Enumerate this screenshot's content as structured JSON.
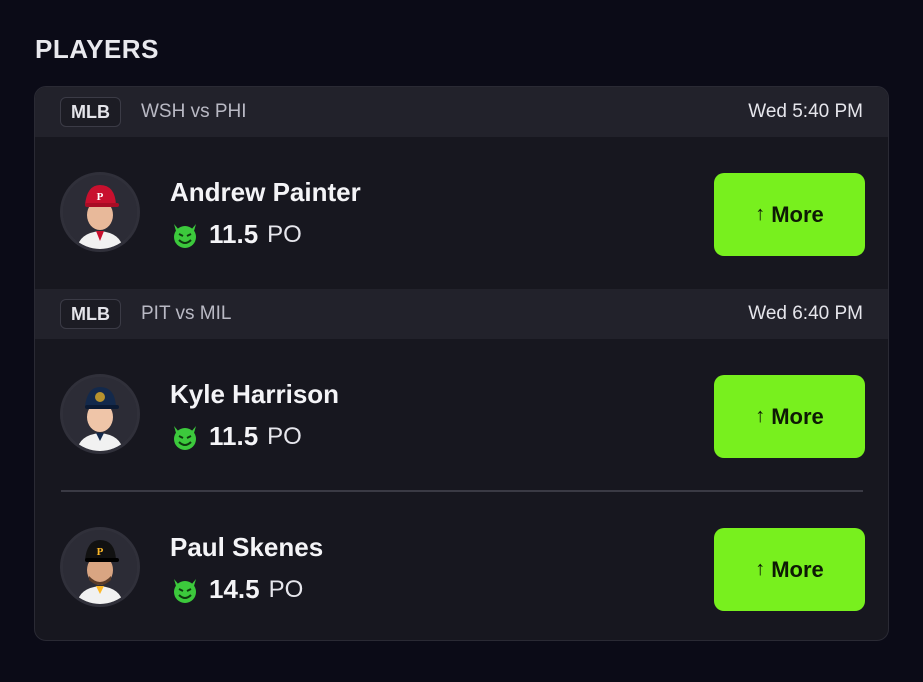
{
  "section": {
    "title": "PLAYERS"
  },
  "games": [
    {
      "league": "MLB",
      "matchup": "WSH vs PHI",
      "time": "Wed 5:40 PM",
      "players": [
        {
          "name": "Andrew Painter",
          "value": "11.5",
          "stat": "PO",
          "button_label": "More",
          "cap_color": "#c8102e",
          "cap_letter": "P",
          "jersey_color": "#f1f1f1",
          "accent": "#c8102e"
        }
      ]
    },
    {
      "league": "MLB",
      "matchup": "PIT vs MIL",
      "time": "Wed 6:40 PM",
      "players": [
        {
          "name": "Kyle Harrison",
          "value": "11.5",
          "stat": "PO",
          "button_label": "More",
          "cap_color": "#13294b",
          "cap_letter": "",
          "jersey_color": "#f1f1f1",
          "accent": "#b6922e"
        },
        {
          "name": "Paul Skenes",
          "value": "14.5",
          "stat": "PO",
          "button_label": "More",
          "cap_color": "#111111",
          "cap_letter": "P",
          "jersey_color": "#f1f1f1",
          "accent": "#fdb827"
        }
      ]
    }
  ],
  "colors": {
    "background": "#0b0b17",
    "card": "#17171f",
    "header": "#22222b",
    "button": "#78f01e",
    "devil_icon": "#3cc93c"
  },
  "icons": {
    "arrow": "arrow-up-icon",
    "devil": "devil-emoji-icon"
  }
}
